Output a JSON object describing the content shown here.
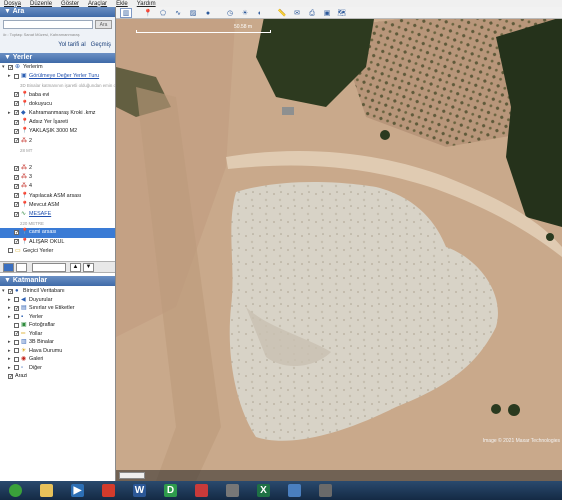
{
  "menubar": {
    "items": [
      "Dosya",
      "Düzenle",
      "Göster",
      "Araçlar",
      "Ekle",
      "Yardım"
    ]
  },
  "search": {
    "header": "▼ Ara",
    "button_label": "Ara",
    "hint": "ör.: Toptaşı Sanat Müzesi, Kahramanmaraş",
    "link_directions": "Yol tarifi al",
    "link_history": "Geçmiş"
  },
  "places": {
    "header": "▼ Yerler",
    "items": [
      {
        "label": "Yerlerim",
        "icon": "my-places-icon",
        "checked": true,
        "indent": 0,
        "exp": "▾"
      },
      {
        "label": "Görülmeye Değer Yerler Turu",
        "icon": "tour-icon",
        "checked": false,
        "indent": 1,
        "exp": "▸",
        "style": "link"
      },
      {
        "label": "3D Binalar katmanının işaretli olduğundan emin olun",
        "icon": "",
        "checked": null,
        "indent": 2,
        "exp": "",
        "style": "sub"
      },
      {
        "label": "baba evi",
        "icon": "pin-icon",
        "checked": true,
        "indent": 1,
        "exp": ""
      },
      {
        "label": "dokuyucu",
        "icon": "pin-icon",
        "checked": true,
        "indent": 1,
        "exp": ""
      },
      {
        "label": "Kahramanmaraş Kroki .kmz",
        "icon": "kmz-icon",
        "checked": true,
        "indent": 1,
        "exp": "▸"
      },
      {
        "label": "Adsız Yer İşareti",
        "icon": "pin-icon",
        "checked": true,
        "indent": 1,
        "exp": ""
      },
      {
        "label": "YAKLAŞIK 3000 M2",
        "icon": "pin-icon",
        "checked": true,
        "indent": 1,
        "exp": ""
      },
      {
        "label": "2",
        "icon": "dots-icon",
        "checked": true,
        "indent": 1,
        "exp": ""
      },
      {
        "label": "28 MT",
        "icon": "",
        "checked": null,
        "indent": 2,
        "exp": "",
        "style": "sub"
      },
      {
        "label": "",
        "icon": "",
        "checked": null,
        "indent": 1,
        "exp": ""
      },
      {
        "label": "2",
        "icon": "dots-icon",
        "checked": true,
        "indent": 1,
        "exp": ""
      },
      {
        "label": "3",
        "icon": "dots-icon",
        "checked": true,
        "indent": 1,
        "exp": ""
      },
      {
        "label": "4",
        "icon": "dots-icon",
        "checked": true,
        "indent": 1,
        "exp": ""
      },
      {
        "label": "Yapılacak ASM arsası",
        "icon": "pin-icon",
        "checked": true,
        "indent": 1,
        "exp": ""
      },
      {
        "label": "Mevcut ASM",
        "icon": "pin-icon",
        "checked": true,
        "indent": 1,
        "exp": ""
      },
      {
        "label": "MESAFE",
        "icon": "path-icon",
        "checked": true,
        "indent": 1,
        "exp": "",
        "style": "link"
      },
      {
        "label": "220 METRE",
        "icon": "",
        "checked": null,
        "indent": 2,
        "exp": "",
        "style": "sub"
      },
      {
        "label": "cami arsası",
        "icon": "pin-icon",
        "checked": true,
        "indent": 1,
        "exp": "",
        "style": "sel"
      },
      {
        "label": "ALIŞAR OKUL",
        "icon": "pin-icon",
        "checked": true,
        "indent": 1,
        "exp": ""
      },
      {
        "label": "Geçici Yerler",
        "icon": "folder-icon",
        "checked": false,
        "indent": 0,
        "exp": ""
      }
    ]
  },
  "layers": {
    "header": "▼ Katmanlar",
    "items": [
      {
        "label": "Birincil Veritabanı",
        "icon": "globe-icon",
        "checked": true,
        "indent": 0,
        "exp": "▾"
      },
      {
        "label": "Duyurular",
        "icon": "megaphone-icon",
        "checked": false,
        "indent": 1,
        "exp": "▸"
      },
      {
        "label": "Sınırlar ve Etiketler",
        "icon": "borders-icon",
        "checked": true,
        "indent": 1,
        "exp": "▸"
      },
      {
        "label": "Yerler",
        "icon": "places-icon",
        "checked": false,
        "indent": 1,
        "exp": "▸"
      },
      {
        "label": "Fotoğraflar",
        "icon": "photo-icon",
        "checked": false,
        "indent": 1,
        "exp": ""
      },
      {
        "label": "Yollar",
        "icon": "roads-icon",
        "checked": true,
        "indent": 1,
        "exp": ""
      },
      {
        "label": "3B Binalar",
        "icon": "buildings-icon",
        "checked": false,
        "indent": 1,
        "exp": "▸"
      },
      {
        "label": "Hava Durumu",
        "icon": "weather-icon",
        "checked": false,
        "indent": 1,
        "exp": "▸"
      },
      {
        "label": "Galeri",
        "icon": "gallery-icon",
        "checked": false,
        "indent": 1,
        "exp": "▸"
      },
      {
        "label": "Diğer",
        "icon": "other-icon",
        "checked": false,
        "indent": 1,
        "exp": "▸"
      },
      {
        "label": "Arazi",
        "icon": "",
        "checked": true,
        "indent": 0,
        "exp": ""
      }
    ]
  },
  "map": {
    "scale_label": "50.58 m",
    "copyright": "Image © 2021 Maxar Technologies",
    "toolbar_icons": [
      "sidebar-toggle-icon",
      "placemark-icon",
      "polygon-icon",
      "path-icon",
      "image-overlay-icon",
      "record-tour-icon",
      "historical-imagery-icon",
      "sun-icon",
      "planets-icon",
      "ruler-icon",
      "email-icon",
      "print-icon",
      "save-image-icon",
      "maps-icon"
    ]
  },
  "taskbar": {
    "items": [
      {
        "name": "start-button",
        "glyph": "",
        "color": "#3aa13a"
      },
      {
        "name": "explorer-icon",
        "glyph": "",
        "color": "#e7c15a"
      },
      {
        "name": "media-player-icon",
        "glyph": "▶",
        "color": "#2c6fb5"
      },
      {
        "name": "chrome-icon",
        "glyph": "",
        "color": "#d33b2c"
      },
      {
        "name": "word-icon",
        "glyph": "W",
        "color": "#2b5797"
      },
      {
        "name": "d-app-icon",
        "glyph": "D",
        "color": "#2e9b4c"
      },
      {
        "name": "app-icon-1",
        "glyph": "",
        "color": "#c93a3a"
      },
      {
        "name": "app-icon-2",
        "glyph": "",
        "color": "#777777"
      },
      {
        "name": "excel-icon",
        "glyph": "X",
        "color": "#1e7145"
      },
      {
        "name": "google-earth-icon",
        "glyph": "",
        "color": "#4a7fbf"
      },
      {
        "name": "app-icon-3",
        "glyph": "",
        "color": "#6a6a6a"
      }
    ]
  }
}
